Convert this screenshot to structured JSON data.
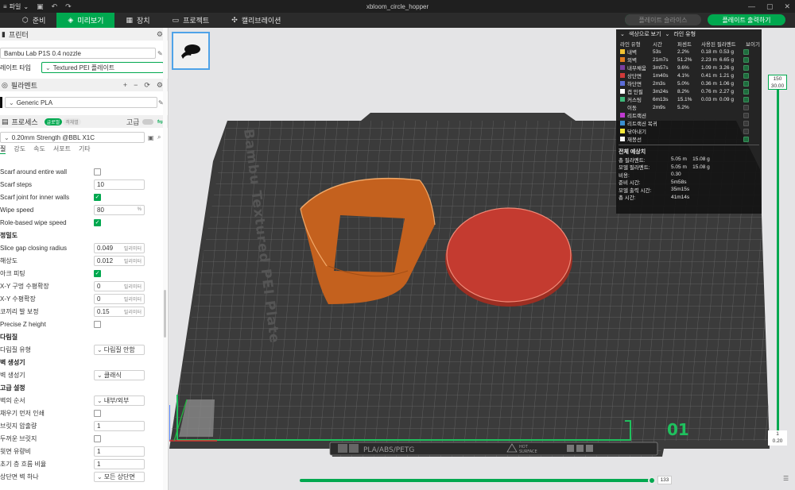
{
  "topbar": {
    "file_label": "파일",
    "window_title": "xbloom_circle_hopper"
  },
  "tabs": [
    {
      "label": "준비",
      "icon": "cube-icon"
    },
    {
      "label": "미리보기",
      "icon": "preview-icon"
    },
    {
      "label": "장치",
      "icon": "device-icon"
    },
    {
      "label": "프로젝트",
      "icon": "project-icon"
    },
    {
      "label": "캘리브레이션",
      "icon": "calibration-icon"
    }
  ],
  "actions": {
    "slice_label": "플레이트 슬라이스",
    "print_label": "플레이트 출력하기"
  },
  "printer": {
    "section_title": "프린터",
    "printer_name": "Bambu Lab P1S 0.4 nozzle",
    "plate_type_label": "레이트 타입",
    "plate_type_value": "Textured PEI 플레이트"
  },
  "filament": {
    "section_title": "필라멘트",
    "filament_value": "Generic PLA"
  },
  "process": {
    "section_title": "프로세스",
    "global_label": "글로벌",
    "object_label": "객체별",
    "advanced_label": "고급",
    "preset_value": "0.20mm Strength @BBL X1C",
    "subtabs": [
      "질",
      "강도",
      "속도",
      "서포트",
      "기타"
    ]
  },
  "params": [
    {
      "type": "check",
      "label": "Scarf around entire wall",
      "checked": false
    },
    {
      "type": "input",
      "label": "Scarf steps",
      "value": "10",
      "unit": ""
    },
    {
      "type": "check",
      "label": "Scarf joint for inner walls",
      "checked": true
    },
    {
      "type": "input",
      "label": "Wipe speed",
      "value": "80",
      "unit": "%"
    },
    {
      "type": "check",
      "label": "Role-based wipe speed",
      "checked": true
    },
    {
      "type": "group",
      "label": "정밀도"
    },
    {
      "type": "input",
      "label": "Slice gap closing radius",
      "value": "0.049",
      "unit": "밀리미터"
    },
    {
      "type": "input",
      "label": "해상도",
      "value": "0.012",
      "unit": "밀리미터"
    },
    {
      "type": "check",
      "label": "아크 피팅",
      "checked": true
    },
    {
      "type": "input",
      "label": "X-Y 구멍 수평확장",
      "value": "0",
      "unit": "밀리미터"
    },
    {
      "type": "input",
      "label": "X-Y 수평확장",
      "value": "0",
      "unit": "밀리미터"
    },
    {
      "type": "input",
      "label": "코끼리 발 보정",
      "value": "0.15",
      "unit": "밀리미터"
    },
    {
      "type": "check",
      "label": "Precise Z height",
      "checked": false
    },
    {
      "type": "group",
      "label": "다림질"
    },
    {
      "type": "select",
      "label": "다림질 유형",
      "value": "다림질 안함"
    },
    {
      "type": "group",
      "label": "벽 생성기"
    },
    {
      "type": "select",
      "label": "벽 생성기",
      "value": "클래식"
    },
    {
      "type": "group",
      "label": "고급 설정"
    },
    {
      "type": "select",
      "label": "벽의 순서",
      "value": "내부/외부"
    },
    {
      "type": "check",
      "label": "채우기 먼저 인쇄",
      "checked": false
    },
    {
      "type": "input",
      "label": "브릿지 압출량",
      "value": "1",
      "unit": ""
    },
    {
      "type": "check",
      "label": "두꺼운 브릿지",
      "checked": false
    },
    {
      "type": "input",
      "label": "윗면 유량비",
      "value": "1",
      "unit": ""
    },
    {
      "type": "input",
      "label": "초기 층 흐름 비율",
      "value": "1",
      "unit": ""
    },
    {
      "type": "select",
      "label": "상단면 벽 하나",
      "value": "모든 상단면"
    }
  ],
  "plate": {
    "vertical_brand": "Bambu Textured PEI Plate",
    "plate_number": "01",
    "bottom_label": "PLA/ABS/PETG",
    "hot_label": "HOT",
    "surface_label": "SURFACE"
  },
  "stats": {
    "view_label": "색상으로 보기",
    "line_type_label": "라인 유형",
    "columns": [
      "라인 유형",
      "시간",
      "퍼센트",
      "사용된 필라멘트",
      "보이기"
    ],
    "rows": [
      {
        "name": "내벽",
        "time": "53s",
        "pct": "2.2%",
        "len": "0.18 m",
        "weight": "0.53 g",
        "color": "#f1c232",
        "visible": true
      },
      {
        "name": "외벽",
        "time": "21m7s",
        "pct": "51.2%",
        "len": "2.23 m",
        "weight": "6.65 g",
        "color": "#e07a1f",
        "visible": true
      },
      {
        "name": "내부채움",
        "time": "3m57s",
        "pct": "9.6%",
        "len": "1.09 m",
        "weight": "3.26 g",
        "color": "#7b3fa0",
        "visible": true
      },
      {
        "name": "상단면",
        "time": "1m40s",
        "pct": "4.1%",
        "len": "0.41 m",
        "weight": "1.21 g",
        "color": "#d03a3a",
        "visible": true
      },
      {
        "name": "하단면",
        "time": "2m3s",
        "pct": "5.0%",
        "len": "0.36 m",
        "weight": "1.06 g",
        "color": "#5b6dd8",
        "visible": true
      },
      {
        "name": "갭 인필",
        "time": "3m24s",
        "pct": "8.2%",
        "len": "0.76 m",
        "weight": "2.27 g",
        "color": "#ffffff",
        "visible": true
      },
      {
        "name": "커스팅",
        "time": "6m13s",
        "pct": "15.1%",
        "len": "0.03 m",
        "weight": "0.09 g",
        "color": "#3fb87a",
        "visible": true
      },
      {
        "name": "이동",
        "time": "2m9s",
        "pct": "5.2%",
        "len": "",
        "weight": "",
        "color": "",
        "visible": false
      },
      {
        "name": "리트랙션",
        "time": "",
        "pct": "",
        "len": "",
        "weight": "",
        "color": "#c03ad0",
        "visible": false
      },
      {
        "name": "리트랙션 복귀",
        "time": "",
        "pct": "",
        "len": "",
        "weight": "",
        "color": "#3a8fd0",
        "visible": false
      },
      {
        "name": "닦아내기",
        "time": "",
        "pct": "",
        "len": "",
        "weight": "",
        "color": "#f5e83a",
        "visible": false
      },
      {
        "name": "재봉선",
        "time": "",
        "pct": "",
        "len": "",
        "weight": "",
        "color": "#f5f5f5",
        "visible": true
      }
    ],
    "estimate_title": "전체 예상치",
    "estimates": [
      {
        "k": "총 필라멘트:",
        "v": "5.05 m    15.08 g"
      },
      {
        "k": "모델 필라멘트:",
        "v": "5.05 m    15.08 g"
      },
      {
        "k": "비용:",
        "v": "0.30"
      },
      {
        "k": "준비 시간:",
        "v": "5m58s"
      },
      {
        "k": "모델 출력 시간:",
        "v": "35m15s"
      },
      {
        "k": "총 시간:",
        "v": "41m14s"
      }
    ]
  },
  "layer_slider": {
    "top_layer": "150",
    "top_height": "30.00",
    "bottom_layer": "1",
    "bottom_height": "0.20"
  },
  "move_slider": {
    "value": "133"
  }
}
